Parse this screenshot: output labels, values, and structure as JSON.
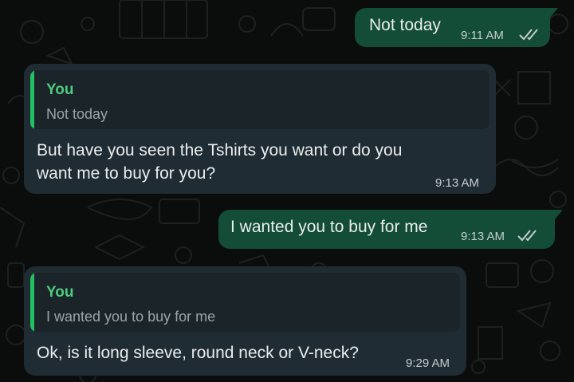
{
  "chat": {
    "messages": [
      {
        "direction": "outgoing",
        "text": "Not today",
        "time": "9:11 AM",
        "status": "read",
        "status_icon": "double-check-icon"
      },
      {
        "direction": "incoming",
        "reply_to": {
          "author": "You",
          "text": "Not today"
        },
        "text_lines": [
          "But have you seen the Tshirts you want or do you",
          "want me to buy for you?"
        ],
        "time": "9:13 AM"
      },
      {
        "direction": "outgoing",
        "text": "I wanted you to buy for me",
        "time": "9:13 AM",
        "status": "read",
        "status_icon": "double-check-icon"
      },
      {
        "direction": "incoming",
        "reply_to": {
          "author": "You",
          "text": "I wanted you to buy for me"
        },
        "text": "Ok, is it long sleeve, round neck or V-neck?",
        "time": "9:29 AM"
      }
    ]
  },
  "colors": {
    "background": "#0b0d0c",
    "outgoing_bubble": "#134d37",
    "incoming_bubble": "#202c33",
    "reply_accent": "#21c063",
    "reply_author": "#4ecb80"
  }
}
